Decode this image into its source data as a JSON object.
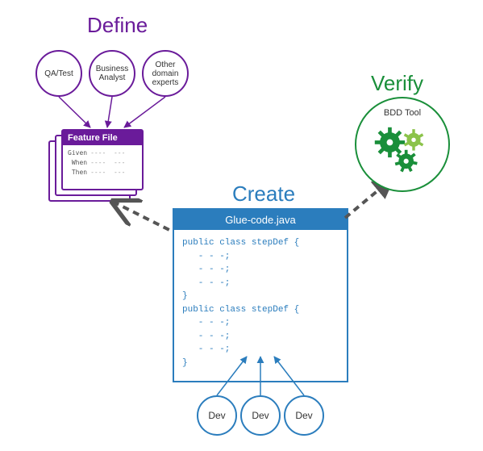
{
  "stages": {
    "define": "Define",
    "create": "Create",
    "verify": "Verify"
  },
  "define": {
    "roles": {
      "qa": "QA/Test",
      "analyst": "Business\nAnalyst",
      "expert": "Other\ndomain\nexperts"
    },
    "feature_file": {
      "title": "Feature File",
      "keywords": [
        "Given",
        "When",
        "Then"
      ],
      "placeholder_rows": [
        "----  ---",
        "----  ---",
        "----  ---"
      ]
    }
  },
  "create": {
    "file_name": "Glue-code.java",
    "code": "public class stepDef {\n   - - -;\n   - - -;\n   - - -;\n}\npublic class stepDef {\n   - - -;\n   - - -;\n   - - -;\n}",
    "devs": [
      "Dev",
      "Dev",
      "Dev"
    ]
  },
  "verify": {
    "tool_label": "BDD Tool"
  },
  "colors": {
    "define": "#6a1b9a",
    "create": "#2b7dbd",
    "verify_dark": "#1a8f3a",
    "verify_light": "#8bc34a",
    "arrow": "#555555"
  }
}
